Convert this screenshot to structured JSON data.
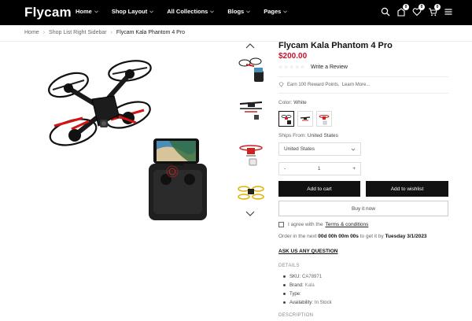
{
  "header": {
    "logo": "Flycam",
    "nav": [
      {
        "label": "Home"
      },
      {
        "label": "Shop Layout"
      },
      {
        "label": "All Collections"
      },
      {
        "label": "Blogs"
      },
      {
        "label": "Pages"
      }
    ],
    "icons": {
      "search": "search-icon",
      "compare": "compare-icon",
      "wishlist": "heart-icon",
      "cart": "cart-icon",
      "menu": "menu-icon"
    },
    "badges": {
      "compare": "0",
      "wishlist": "0",
      "cart": "0"
    }
  },
  "breadcrumb": {
    "home": "Home",
    "sep": "›",
    "parent": "Shop List Right Sidebar",
    "current": "Flycam Kala Phantom 4 Pro"
  },
  "product": {
    "title": "Flycam Kala Phantom 4 Pro",
    "price": "$200.00",
    "review_link": "Write a Review",
    "reward_text": "Earn 100 Reward Points.",
    "learn_more": "Learn More...",
    "color_label": "Color:",
    "color_value": "White",
    "ships_label": "Ships From:",
    "ships_value": "United States",
    "ships_selected": "United States",
    "qty_minus": "-",
    "qty_value": "1",
    "qty_plus": "+",
    "add_to_cart": "Add to cart",
    "add_to_wishlist": "Add to wishlist",
    "buy_now": "Buy it now",
    "agree_text": "I agree with the",
    "terms": "Terms & conditions",
    "order_prefix": "Order in the next",
    "order_countdown": "00d 00h 00m 00s",
    "order_middle": "to get it by",
    "order_date": "Tuesday 3/1/2023",
    "ask_question": "ASK US ANY QUESTION",
    "details_heading": "DETAILS",
    "details": [
      {
        "key": "SKU:",
        "value": "CA78971"
      },
      {
        "key": "Brand:",
        "value": "Kala"
      },
      {
        "key": "Type:",
        "value": ""
      },
      {
        "key": "Availability:",
        "value": "In Stock"
      }
    ],
    "description_heading": "DESCRIPTION"
  },
  "colors": {
    "accent": "#c8102e",
    "dark": "#111111",
    "header_bg": "#000000"
  }
}
